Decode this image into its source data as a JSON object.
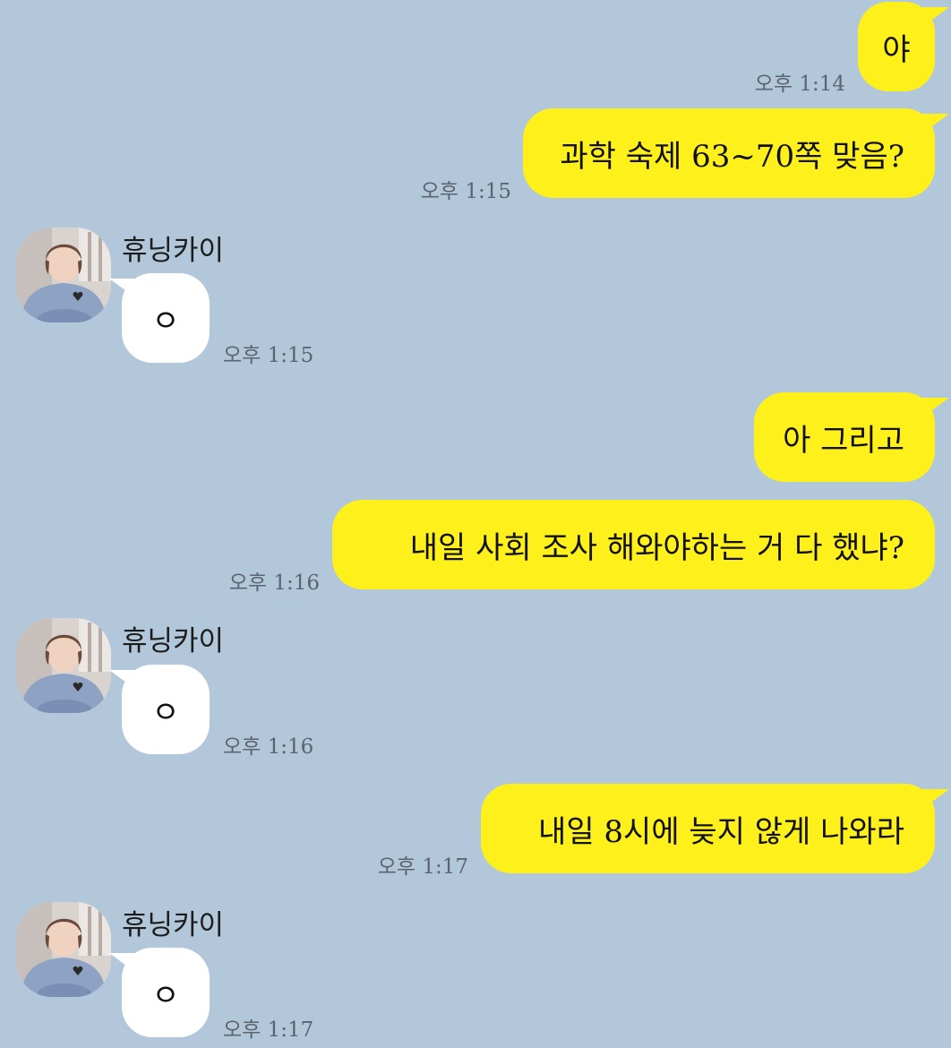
{
  "chat": {
    "background_color": "#b2c7da",
    "sent_bubble_color": "#fef01b",
    "received_bubble_color": "#ffffff",
    "messages": [
      {
        "direction": "sent",
        "text": "야",
        "time": "오후 1:14"
      },
      {
        "direction": "sent",
        "text": "과학 숙제 63~70쪽 맞음?",
        "time": "오후 1:15"
      },
      {
        "direction": "received",
        "sender": "휴닝카이",
        "avatar": "profile-photo",
        "text": "ㅇ",
        "time": "오후 1:15"
      },
      {
        "direction": "sent",
        "text": "아 그리고",
        "time": ""
      },
      {
        "direction": "sent",
        "text": "내일 사회 조사 해와야하는 거 다 했냐?",
        "time": "오후 1:16"
      },
      {
        "direction": "received",
        "sender": "휴닝카이",
        "avatar": "profile-photo",
        "text": "ㅇ",
        "time": "오후 1:16"
      },
      {
        "direction": "sent",
        "text": "내일 8시에 늦지 않게 나와라",
        "time": "오후 1:17"
      },
      {
        "direction": "received",
        "sender": "휴닝카이",
        "avatar": "profile-photo",
        "text": "ㅇ",
        "time": "오후 1:17"
      }
    ]
  }
}
